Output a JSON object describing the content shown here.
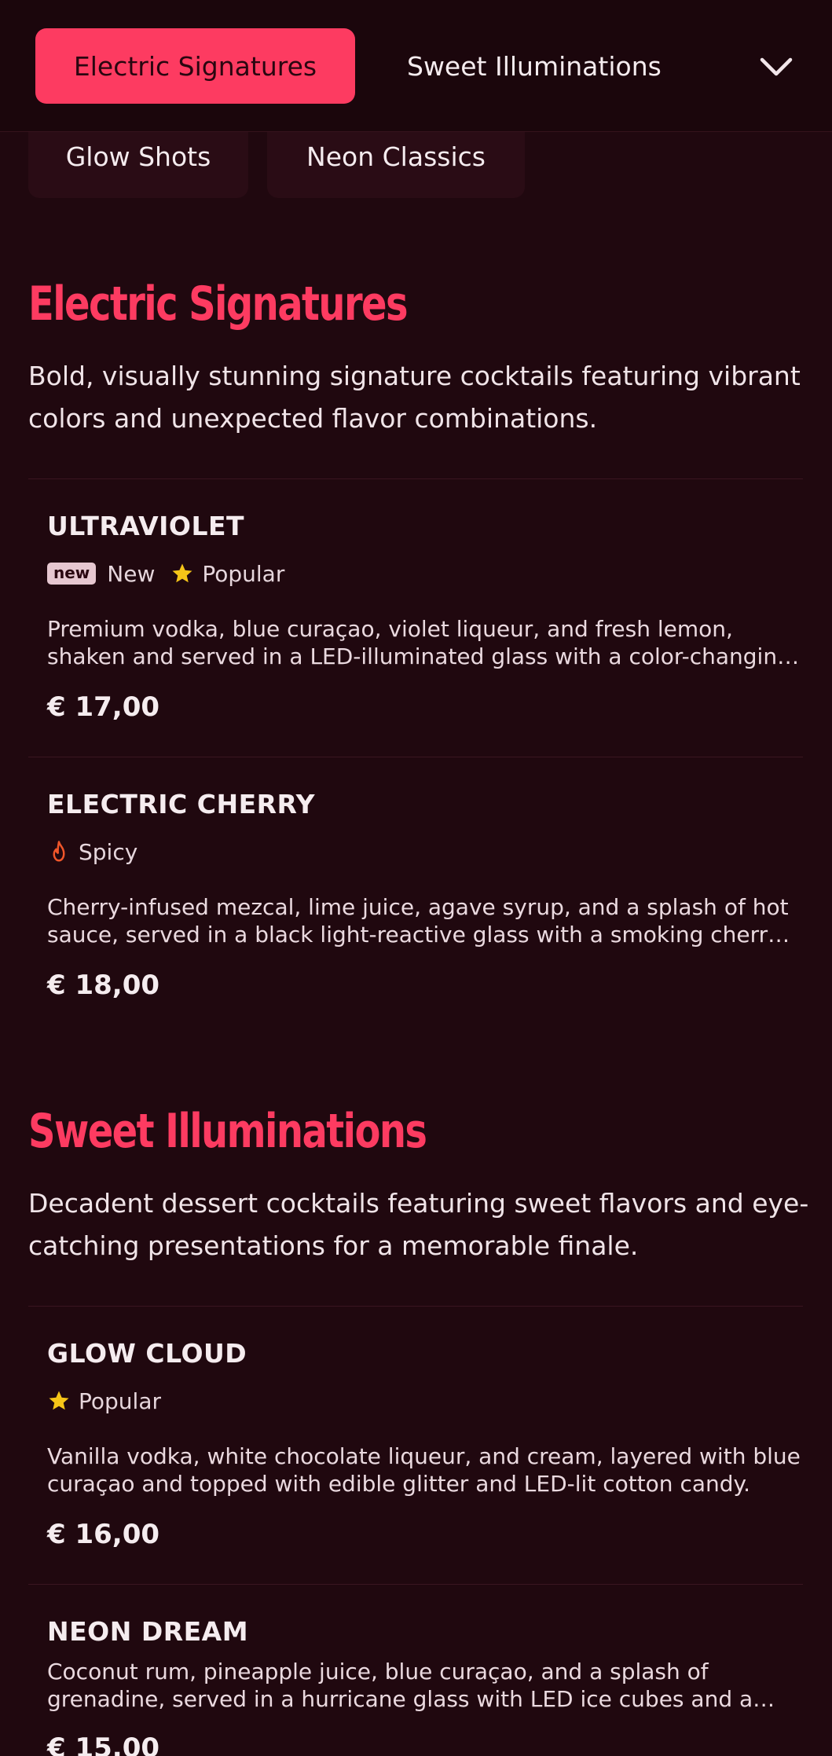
{
  "nav": {
    "tabs": [
      {
        "label": "Electric Signatures",
        "active": true
      },
      {
        "label": "Sweet Illuminations",
        "active": false
      }
    ],
    "chips": [
      {
        "label": "Glow Shots"
      },
      {
        "label": "Neon Classics"
      }
    ],
    "more_icon": "chevron-down-icon"
  },
  "sections": [
    {
      "title": "Electric Signatures",
      "description": "Bold, visually stunning signature cocktails featuring vibrant colors and unexpected flavor combinations.",
      "items": [
        {
          "name": "ULTRAVIOLET",
          "badge": "new",
          "tags": [
            "New",
            "Popular"
          ],
          "description": "Premium vodka, blue curaçao, violet liqueur, and fresh lemon, shaken and served in a LED-illuminated glass with a color-changing ice cube for an otherworldly experience.",
          "price": "€ 17,00"
        },
        {
          "name": "ELECTRIC CHERRY",
          "tags": [
            "Spicy"
          ],
          "description": "Cherry-infused mezcal, lime juice, agave syrup, and a splash of hot sauce, served in a black light-reactive glass with a smoking cherry garnish.",
          "price": "€ 18,00"
        }
      ]
    },
    {
      "title": "Sweet Illuminations",
      "description": "Decadent dessert cocktails featuring sweet flavors and eye-catching presentations for a memorable finale.",
      "items": [
        {
          "name": "GLOW CLOUD",
          "tags": [
            "Popular"
          ],
          "description": "Vanilla vodka, white chocolate liqueur, and cream, layered with blue curaçao and topped with edible glitter and LED-lit cotton candy.",
          "price": "€ 16,00"
        },
        {
          "name": "NEON DREAM",
          "description": "Coconut rum, pineapple juice, blue curaçao, and a splash of grenadine, served in a hurricane glass with LED ice cubes and a neon straw.",
          "price": "€ 15,00"
        }
      ]
    }
  ],
  "colors": {
    "background": "#20080f",
    "accent": "#fd3b61",
    "star": "#f5c518",
    "flame": "#f0562a"
  }
}
